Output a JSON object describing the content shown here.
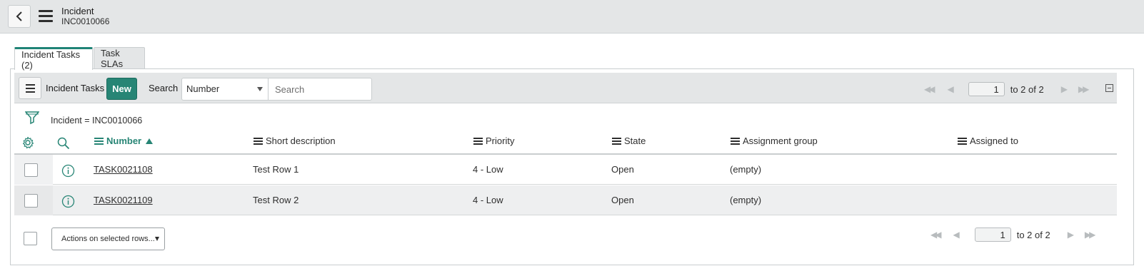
{
  "header": {
    "title": "Incident",
    "record_number": "INC0010066",
    "back_icon": "chevron-left-icon",
    "menu_icon": "hamburger-menu-icon"
  },
  "tabs": [
    {
      "label": "Incident Tasks (2)",
      "active": true
    },
    {
      "label": "Task SLAs",
      "active": false
    }
  ],
  "list_toolbar": {
    "title": "Incident Tasks",
    "new_label": "New",
    "search_label": "Search",
    "search_field": "Number",
    "search_placeholder": "Search"
  },
  "pagination_top": {
    "page": "1",
    "range_text": "to 2 of 2"
  },
  "filter": {
    "text": "Incident = INC0010066"
  },
  "columns": [
    {
      "label": "Number",
      "sorted": "ascending"
    },
    {
      "label": "Short description"
    },
    {
      "label": "Priority"
    },
    {
      "label": "State"
    },
    {
      "label": "Assignment group"
    },
    {
      "label": "Assigned to"
    }
  ],
  "rows": [
    {
      "number": "TASK0021108",
      "short_description": "Test Row 1",
      "priority": "4 - Low",
      "state": "Open",
      "assignment_group": "(empty)",
      "assigned_to": ""
    },
    {
      "number": "TASK0021109",
      "short_description": "Test Row 2",
      "priority": "4 - Low",
      "state": "Open",
      "assignment_group": "(empty)",
      "assigned_to": ""
    }
  ],
  "footer": {
    "actions_label": "Actions on selected rows...",
    "page": "1",
    "range_text": "to 2 of 2"
  },
  "colors": {
    "accent": "#278575",
    "header_bg": "#e4e6e7",
    "row_alt_bg": "#eeeff0"
  }
}
